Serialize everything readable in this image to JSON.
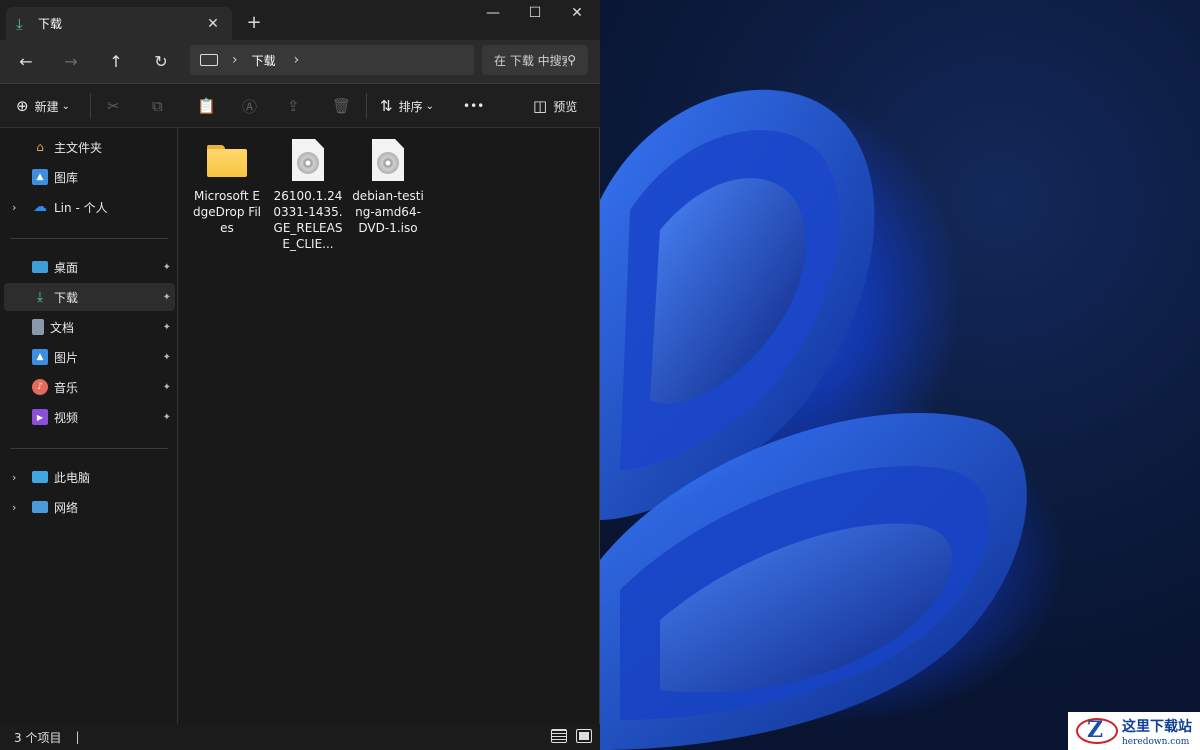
{
  "window": {
    "tab_title": "下载",
    "tab_close": "✕",
    "new_tab": "+",
    "minimize": "—",
    "maximize": "☐",
    "close": "✕"
  },
  "navbar": {
    "back": "←",
    "forward": "→",
    "up": "↑",
    "refresh": "↻",
    "breadcrumb": [
      "下载"
    ],
    "chevron": "›",
    "search_placeholder": "在 下载 中搜索"
  },
  "toolbar": {
    "new_label": "新建",
    "new_icon": "⊕",
    "dropdown": "⌄",
    "cut": "✂",
    "copy": "⧉",
    "paste": "📋",
    "rename": "Ⓐ",
    "share": "⇪",
    "delete": "🗑",
    "sort_label": "排序",
    "sort_icon": "⇅",
    "more": "•••",
    "preview_label": "预览",
    "preview_icon": "◫"
  },
  "sidebar": {
    "group1": [
      {
        "label": "主文件夹",
        "icon": "home-icon"
      },
      {
        "label": "图库",
        "icon": "gallery-icon"
      },
      {
        "label": "Lin - 个人",
        "icon": "onedrive-icon",
        "expandable": true
      }
    ],
    "group2": [
      {
        "label": "桌面",
        "icon": "desktop-icon",
        "pinned": true
      },
      {
        "label": "下载",
        "icon": "download-icon",
        "pinned": true,
        "selected": true
      },
      {
        "label": "文档",
        "icon": "documents-icon",
        "pinned": true
      },
      {
        "label": "图片",
        "icon": "pictures-icon",
        "pinned": true
      },
      {
        "label": "音乐",
        "icon": "music-icon",
        "pinned": true
      },
      {
        "label": "视频",
        "icon": "videos-icon",
        "pinned": true
      }
    ],
    "group3": [
      {
        "label": "此电脑",
        "icon": "this-pc-icon",
        "expandable": true
      },
      {
        "label": "网络",
        "icon": "network-icon",
        "expandable": true
      }
    ],
    "pin_glyph": "📌",
    "expand_glyph": "›"
  },
  "files": [
    {
      "name": "Microsoft EdgeDrop Files",
      "type": "folder"
    },
    {
      "name": "26100.1.240331-1435.GE_RELEASE_CLIE...",
      "type": "iso"
    },
    {
      "name": "debian-testing-amd64-DVD-1.iso",
      "type": "iso"
    }
  ],
  "status": {
    "count_text": "3 个项目",
    "bar": "|"
  },
  "watermark": {
    "logo_letter": "Z",
    "title": "这里下载站",
    "subtitle": "heredown.com"
  },
  "colors": {
    "window_bg": "#191919",
    "accent_download": "#4cc2a4",
    "wallpaper_blue": "#1d4dd8"
  }
}
